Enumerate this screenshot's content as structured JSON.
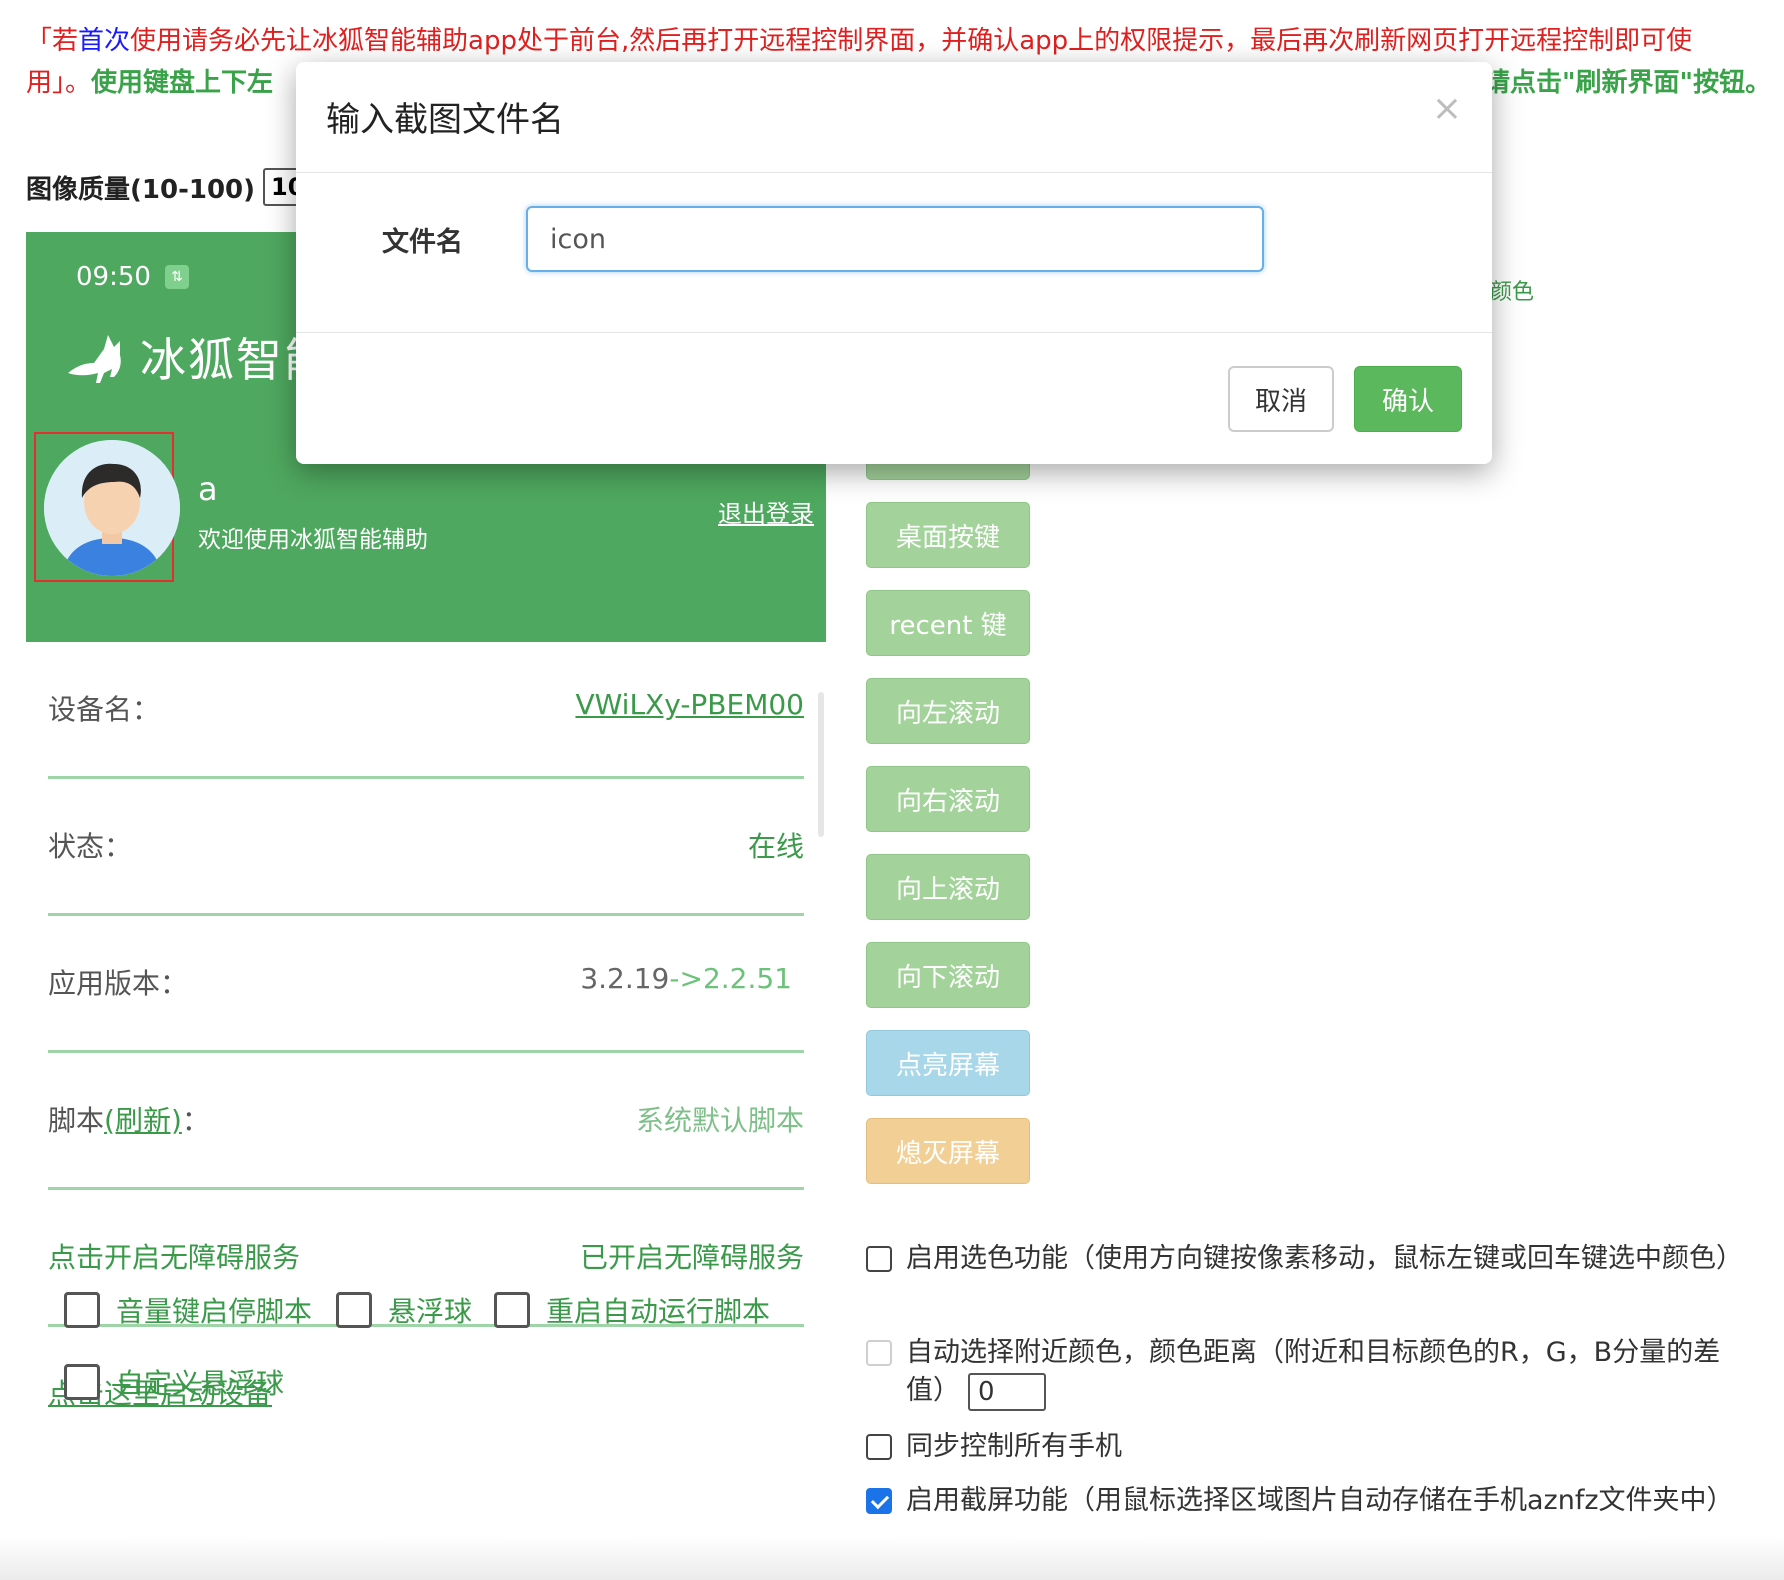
{
  "notice": {
    "part1": "「若",
    "part2": "首次",
    "part3": "使用请务必先让冰狐智能辅助app处于前台,然后再打开远程控制界面，并确认app上的权限提示，最后再次刷新网页打开远程控制即可使用」。",
    "part4": "使用键盘上下左",
    "part5": "请点击\"刷新界面\"按钮。"
  },
  "quality": {
    "label": "图像质量(10-100)",
    "value": "100"
  },
  "phone": {
    "time": "09:50",
    "badge": "⇅",
    "brand": "冰狐智能",
    "user_name": "a",
    "welcome": "欢迎使用冰狐智能辅助",
    "logout": "退出登录",
    "rows": [
      {
        "key": "设备名：",
        "value": "VWiLXy-PBEM00"
      },
      {
        "key": "状态：",
        "value": "在线"
      },
      {
        "key": "应用版本：",
        "value_old": "3.2.19",
        "value_new": "->2.2.51"
      },
      {
        "key_prefix": "脚本",
        "key_link": "(刷新)",
        "key_suffix": "：",
        "value": "系统默认脚本"
      },
      {
        "key": "点击开启无障碍服务",
        "value": "已开启无障碍服务"
      }
    ],
    "start_link": "点击这里启动设备",
    "checks": [
      "音量键启停脚本",
      "悬浮球",
      "重启自动运行脚本",
      "自定义悬浮球"
    ]
  },
  "buttons": [
    "桌面按键",
    "recent 键",
    "向左滚动",
    "向右滚动",
    "向上滚动",
    "向下滚动",
    "点亮屏幕",
    "熄灭屏幕"
  ],
  "fragment_color": "颜色",
  "options": {
    "pick_color": "启用选色功能（使用方向键按像素移动，鼠标左键或回车键选中颜色）",
    "auto_near": "自动选择附近颜色，颜色距离（附近和目标颜色的R，G，B分量的差值）",
    "distance": "0",
    "sync": "同步控制所有手机",
    "screenshot": "启用截屏功能（用鼠标选择区域图片自动存储在手机aznfz文件夹中）"
  },
  "modal": {
    "title": "输入截图文件名",
    "close": "×",
    "label": "文件名",
    "value": "icon",
    "cancel": "取消",
    "ok": "确认"
  },
  "colors": {
    "brand_green": "#4fa85f",
    "accent_blue": "#1a73e8",
    "ok_green": "#5cb85c"
  }
}
